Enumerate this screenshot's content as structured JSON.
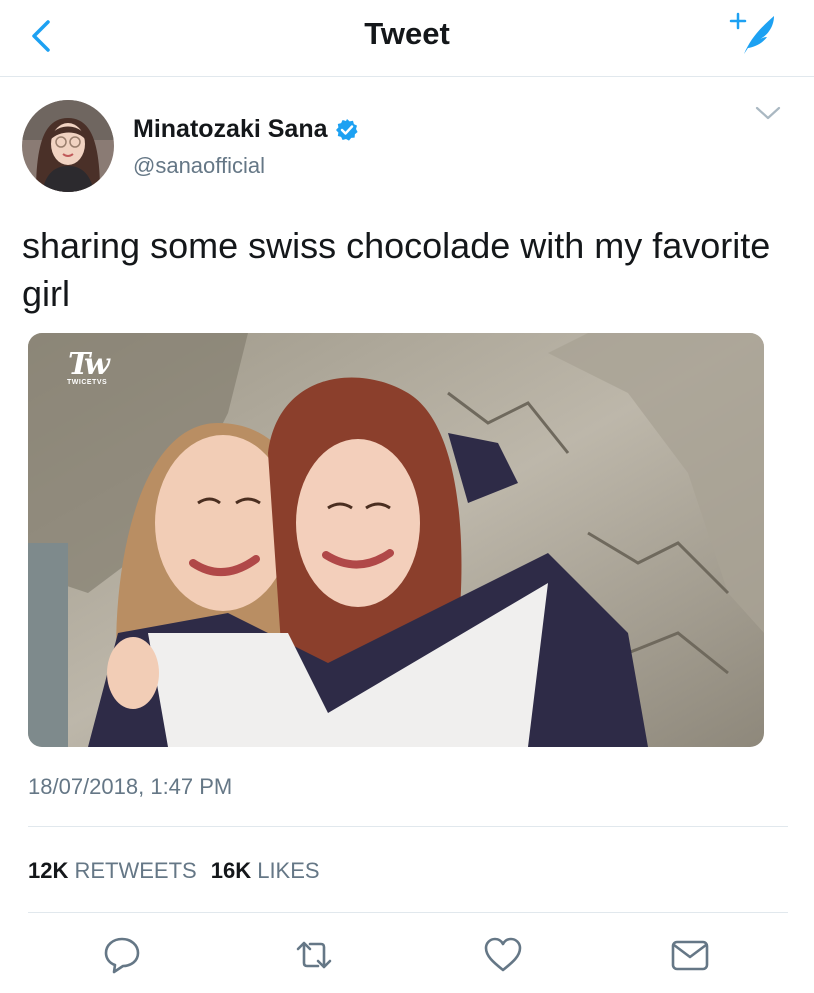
{
  "header": {
    "title": "Tweet",
    "icons": {
      "back": "chevron-left-icon",
      "compose": "compose-tweet-icon"
    }
  },
  "author": {
    "name": "Minatozaki Sana",
    "handle": "@sanaofficial",
    "verified": true,
    "verified_color": "#1da1f2"
  },
  "tweet": {
    "text": "sharing some swiss chocolade with my favorite girl",
    "timestamp": "18/07/2018, 1:47 PM",
    "watermark": "TWICETVS"
  },
  "stats": {
    "retweets_count": "12K",
    "retweets_label": "RETWEETS",
    "likes_count": "16K",
    "likes_label": "LIKES"
  },
  "actions": [
    "reply-icon",
    "retweet-icon",
    "like-icon",
    "direct-message-icon"
  ],
  "colors": {
    "accent": "#1da1f2",
    "muted": "#657786",
    "divider": "#e1e8ed"
  }
}
